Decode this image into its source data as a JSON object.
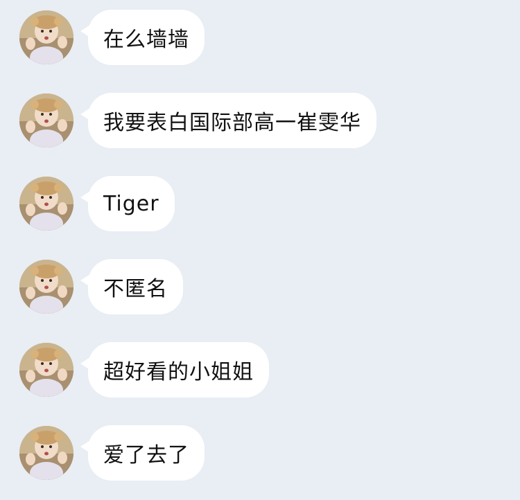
{
  "messages": [
    {
      "text": "在么墙墙"
    },
    {
      "text": "我要表白国际部高一崔雯华"
    },
    {
      "text": "Tiger"
    },
    {
      "text": "不匿名"
    },
    {
      "text": "超好看的小姐姐"
    },
    {
      "text": "爱了去了"
    }
  ],
  "colors": {
    "background": "#e9edf4",
    "bubble": "#ffffff",
    "text": "#111111"
  }
}
